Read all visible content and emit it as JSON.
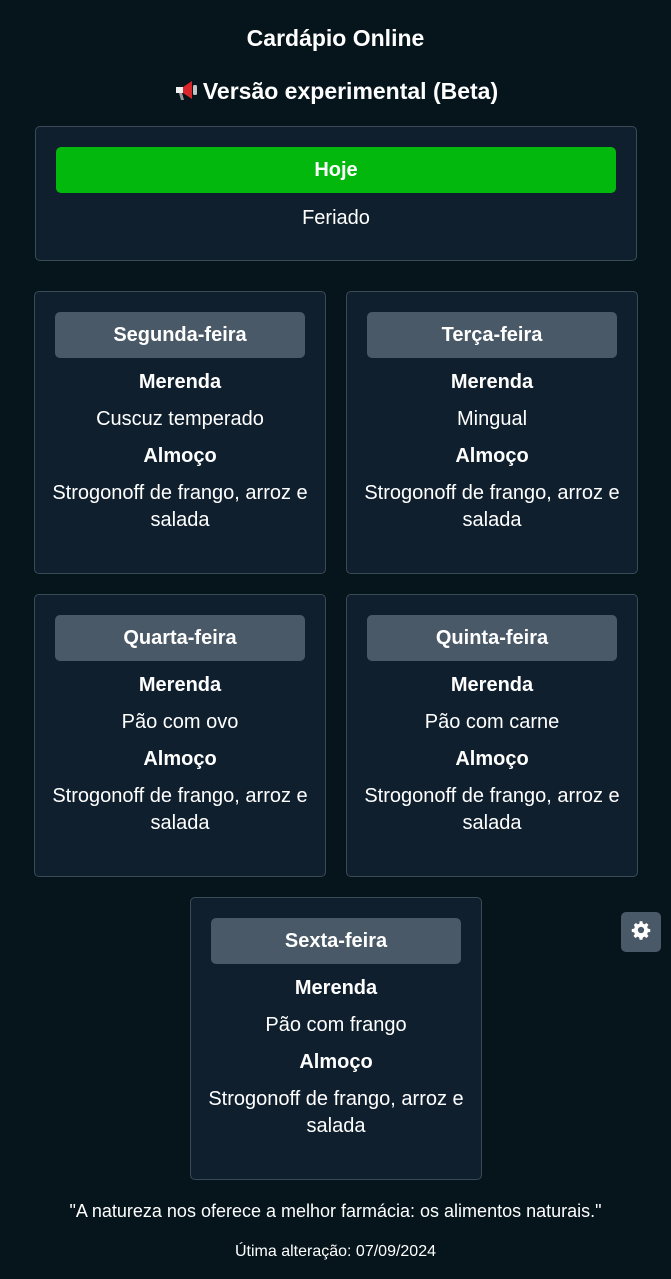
{
  "header": {
    "title": "Cardápio Online",
    "beta_label": "Versão experimental (Beta)",
    "beta_icon": "megaphone-icon"
  },
  "today": {
    "label": "Hoje",
    "status": "Feriado",
    "accent_color": "#02b80d"
  },
  "meal_labels": {
    "snack": "Merenda",
    "lunch": "Almoço"
  },
  "days": [
    {
      "name": "Segunda-feira",
      "snack": "Cuscuz temperado",
      "lunch": "Strogonoff de frango, arroz e salada"
    },
    {
      "name": "Terça-feira",
      "snack": "Mingual",
      "lunch": "Strogonoff de frango, arroz e salada"
    },
    {
      "name": "Quarta-feira",
      "snack": "Pão com ovo",
      "lunch": "Strogonoff de frango, arroz e salada"
    },
    {
      "name": "Quinta-feira",
      "snack": "Pão com carne",
      "lunch": "Strogonoff de frango, arroz e salada"
    },
    {
      "name": "Sexta-feira",
      "snack": "Pão com frango",
      "lunch": "Strogonoff de frango, arroz e salada"
    }
  ],
  "settings": {
    "icon": "gear-icon"
  },
  "footer": {
    "quote": "\"A natureza nos oferece a melhor farmácia: os alimentos naturais.\"",
    "last_updated": "Útima alteração: 07/09/2024"
  }
}
